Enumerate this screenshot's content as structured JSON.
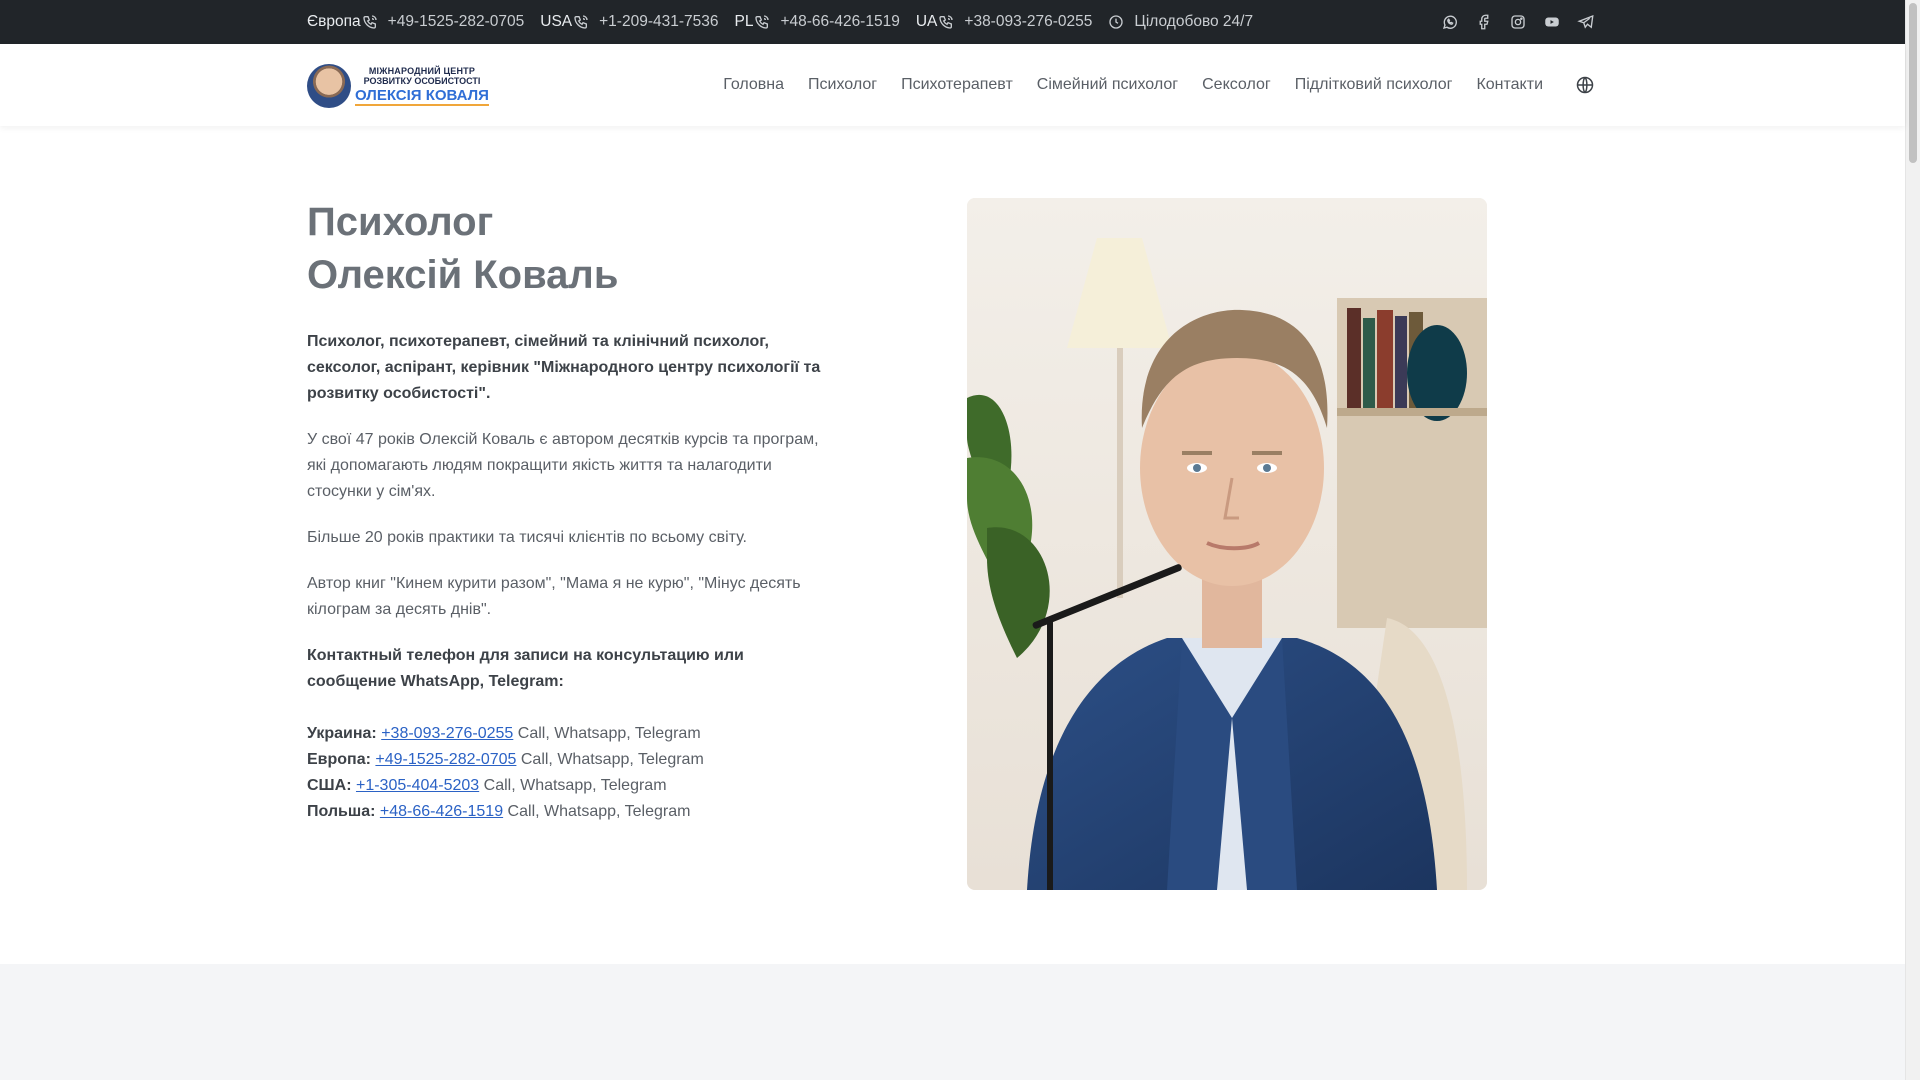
{
  "topbar": {
    "phones": [
      {
        "region": "Європа",
        "number": "+49-1525-282-0705"
      },
      {
        "region": "USA",
        "number": "+1-209-431-7536"
      },
      {
        "region": "PL",
        "number": "+48-66-426-1519"
      },
      {
        "region": "UA",
        "number": "+38-093-276-0255"
      }
    ],
    "hours": "Цілодобово 24/7",
    "social_icons": [
      "whatsapp-icon",
      "facebook-icon",
      "instagram-icon",
      "youtube-icon",
      "telegram-icon"
    ]
  },
  "logo": {
    "line1": "МІЖНАРОДНИЙ ЦЕНТР",
    "line2": "РОЗВИТКУ ОСОБИСТОСТІ",
    "line3": "ОЛЕКСІЯ КОВАЛЯ"
  },
  "nav": {
    "items": [
      "Головна",
      "Психолог",
      "Психотерапевт",
      "Сімейний психолог",
      "Сексолог",
      "Підлітковий психолог",
      "Контакти"
    ],
    "language_icon": "globe-icon"
  },
  "hero": {
    "title_line1": "Психолог",
    "title_line2": "Олексій Коваль",
    "lead": "Психолог, психотерапевт, сімейний та клінічний психолог, сексолог, аспірант, керівник \"Міжнародного центру психології та розвитку особистості\".",
    "para1": "У свої 47 років Олексій Коваль є автором десятків курсів та програм, які допомагають людям покращити якість життя та налагодити стосунки у сім'ях.",
    "para2": "Більше 20 років практики та тисячі клієнтів по всьому світу.",
    "para3": "Автор книг \"Кинем курити разом\", \"Мама я не курю\", \"Мінус десять кілограм за десять днів\".",
    "contact_heading": "Контактный телефон для записи на консультацию или сообщение WhatsApp, Telegram:",
    "contacts": [
      {
        "label": "Украина:",
        "number": "+38-093-276-0255",
        "note": " Call, Whatsapp, Telegram"
      },
      {
        "label": "Европа:",
        "number": "+49-1525-282-0705",
        "note": " Call, Whatsapp, Telegram"
      },
      {
        "label": "США:",
        "number": "+1-305-404-5203",
        "note": " Call, Whatsapp, Telegram"
      },
      {
        "label": "Польша:",
        "number": "+48-66-426-1519",
        "note": " Call, Whatsapp, Telegram"
      }
    ]
  },
  "colors": {
    "topbar_bg": "#212529",
    "link": "#2b62c5",
    "title": "#6b7178"
  }
}
